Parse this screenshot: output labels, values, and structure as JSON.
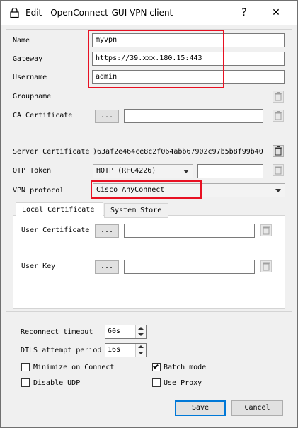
{
  "window": {
    "title": "Edit - OpenConnect-GUI VPN client",
    "help_label": "?",
    "close_label": "✕"
  },
  "form": {
    "name_label": "Name",
    "name_value": "myvpn",
    "gateway_label": "Gateway",
    "gateway_value": "https://39.xxx.180.15:443",
    "username_label": "Username",
    "username_value": "admin",
    "groupname_label": "Groupname",
    "groupname_value": "",
    "ca_label": "CA Certificate",
    "ca_button": "...",
    "ca_value": "",
    "server_cert_label": "Server Certificate",
    "server_cert_value": ")63af2e464ce8c2f064abb67902c97b5b8f99b40",
    "otp_label": "OTP Token",
    "otp_selected": "HOTP (RFC4226)",
    "otp_value": "",
    "protocol_label": "VPN protocol",
    "protocol_selected": "Cisco AnyConnect"
  },
  "tabs": {
    "local_cert": "Local Certificate",
    "system_store": "System Store",
    "user_cert_label": "User Certificate",
    "user_cert_button": "...",
    "user_cert_value": "",
    "user_key_label": "User Key",
    "user_key_button": "...",
    "user_key_value": ""
  },
  "options": {
    "reconnect_label": "Reconnect timeout",
    "reconnect_value": "60s",
    "dtls_label": "DTLS attempt period",
    "dtls_value": "16s",
    "minimize_label": "Minimize on Connect",
    "minimize_checked": false,
    "batch_label": "Batch mode",
    "batch_checked": true,
    "disable_udp_label": "Disable UDP",
    "disable_udp_checked": false,
    "use_proxy_label": "Use Proxy",
    "use_proxy_checked": false
  },
  "buttons": {
    "save": "Save",
    "cancel": "Cancel"
  },
  "colors": {
    "highlight": "#e81123",
    "accent": "#0078d7"
  }
}
